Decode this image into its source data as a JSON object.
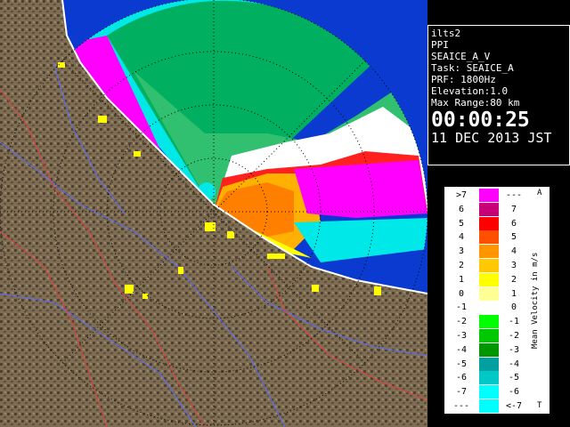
{
  "info": {
    "radar_name": "ilts2",
    "mode": "PPI",
    "product": "SEAICE_A_V",
    "task": "Task: SEAICE_A",
    "prf": "PRF: 1800Hz",
    "elevation": "Elevation:1.0",
    "max_range": "Max Range:80 km",
    "time": "00:00:25",
    "date": "11 DEC 2013 JST"
  },
  "legend": {
    "title": "Mean Velocity in m/s",
    "top_mark": "A",
    "bottom_mark": "T",
    "rows": [
      {
        "left": ">7",
        "right": "---",
        "color": "#ff00ff"
      },
      {
        "left": "6",
        "right": "7",
        "color": "#c80078"
      },
      {
        "left": "5",
        "right": "6",
        "color": "#ff0000"
      },
      {
        "left": "4",
        "right": "5",
        "color": "#ff5000"
      },
      {
        "left": "3",
        "right": "4",
        "color": "#ff9600"
      },
      {
        "left": "2",
        "right": "3",
        "color": "#ffc800"
      },
      {
        "left": "1",
        "right": "2",
        "color": "#ffff00"
      },
      {
        "left": "0",
        "right": "1",
        "color": "#ffff96"
      },
      {
        "left": "-1",
        "right": "0",
        "color": "#ffffff"
      },
      {
        "left": "-2",
        "right": "-1",
        "color": "#00ff00"
      },
      {
        "left": "-3",
        "right": "-2",
        "color": "#00c800"
      },
      {
        "left": "-4",
        "right": "-3",
        "color": "#009600"
      },
      {
        "left": "-5",
        "right": "-4",
        "color": "#00a0a0"
      },
      {
        "left": "-6",
        "right": "-5",
        "color": "#00c8c8"
      },
      {
        "left": "-7",
        "right": "-6",
        "color": "#00ffff"
      },
      {
        "left": "---",
        "right": "<-7",
        "color": "#00ffff"
      }
    ]
  },
  "colors": {
    "sea": "#0a3ad0",
    "land": "#7a6a50",
    "land_dark": "#4e4232",
    "coast": "#ffffff",
    "river": "#5b6cff",
    "border": "#e04040"
  }
}
